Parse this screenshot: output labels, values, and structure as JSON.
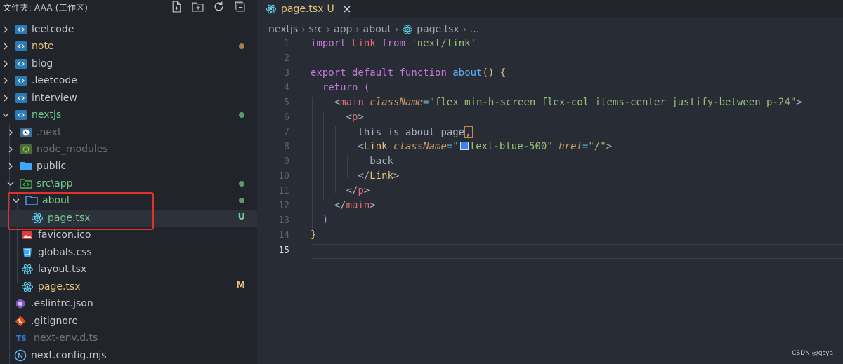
{
  "explorer": {
    "title": "文件夹: AAA (工作区)",
    "tree": [
      {
        "label": "leetcode",
        "color": "#c5c8cf",
        "status": ""
      },
      {
        "label": "note",
        "color": "#e5c07b",
        "status": "dot"
      },
      {
        "label": "blog",
        "color": "#c5c8cf",
        "status": ""
      },
      {
        "label": ".leetcode",
        "color": "#c5c8cf",
        "status": ""
      },
      {
        "label": "interview",
        "color": "#c5c8cf",
        "status": ""
      },
      {
        "label": "nextjs",
        "color": "#73c991",
        "status": "dot"
      },
      {
        "label": ".next",
        "color": "#6f737a",
        "status": ""
      },
      {
        "label": "node_modules",
        "color": "#6f737a",
        "status": ""
      },
      {
        "label": "public",
        "color": "#c5c8cf",
        "status": ""
      },
      {
        "label": "src\\app",
        "color": "#73c991",
        "status": "dot"
      },
      {
        "label": "about",
        "color": "#73c991",
        "status": "dot"
      },
      {
        "label": "page.tsx",
        "color": "#73c991",
        "status": "U"
      },
      {
        "label": "favicon.ico",
        "color": "#c5c8cf",
        "status": ""
      },
      {
        "label": "globals.css",
        "color": "#c5c8cf",
        "status": ""
      },
      {
        "label": "layout.tsx",
        "color": "#c5c8cf",
        "status": ""
      },
      {
        "label": "page.tsx",
        "color": "#e5c07b",
        "status": "M"
      },
      {
        "label": ".eslintrc.json",
        "color": "#c5c8cf",
        "status": ""
      },
      {
        "label": ".gitignore",
        "color": "#c5c8cf",
        "status": ""
      },
      {
        "label": "next-env.d.ts",
        "color": "#6f737a",
        "status": ""
      },
      {
        "label": "next.config.mjs",
        "color": "#c5c8cf",
        "status": ""
      }
    ]
  },
  "tab": {
    "label": "page.tsx",
    "status": "U"
  },
  "breadcrumb": [
    "nextjs",
    "src",
    "app",
    "about",
    "page.tsx",
    "..."
  ],
  "line_numbers": [
    "1",
    "2",
    "3",
    "4",
    "5",
    "6",
    "7",
    "8",
    "9",
    "10",
    "11",
    "12",
    "13",
    "14",
    "15"
  ],
  "code": {
    "l1": {
      "kw1": "import",
      "name": "Link",
      "kw2": "from",
      "str": "'next/link'"
    },
    "l3": {
      "kw1": "export",
      "kw2": "default",
      "kw3": "function",
      "fn": "about",
      "rest": "() {"
    },
    "l4": {
      "kw": "return",
      "rest": "("
    },
    "l5": {
      "open": "<",
      "tag": "main",
      "attr": "className",
      "eq": "=",
      "str": "\"flex min-h-screen flex-col items-center justify-between p-24\"",
      "close": ">"
    },
    "l6": {
      "open": "<",
      "tag": "p",
      "close": ">"
    },
    "l7": {
      "text": "this is about page",
      "comma": ","
    },
    "l8": {
      "open": "<",
      "tag": "Link",
      "attr1": "className",
      "eq": "=",
      "q": "\"",
      "cls": "text-blue-500\"",
      "attr2": "href",
      "href": "\"/\"",
      "close": ">"
    },
    "l9": {
      "text": "back"
    },
    "l10": {
      "open": "</",
      "tag": "Link",
      "close": ">"
    },
    "l11": {
      "open": "</",
      "tag": "p",
      "close": ">"
    },
    "l12": {
      "open": "</",
      "tag": "main",
      "close": ">"
    },
    "l13": {
      "text": ")"
    },
    "l14": {
      "text": "}"
    }
  },
  "colors": {
    "accent_green": "#73c991",
    "modified": "#e5c07b",
    "highlight_border": "#e2312c"
  },
  "watermark": "CSDN @qsya"
}
